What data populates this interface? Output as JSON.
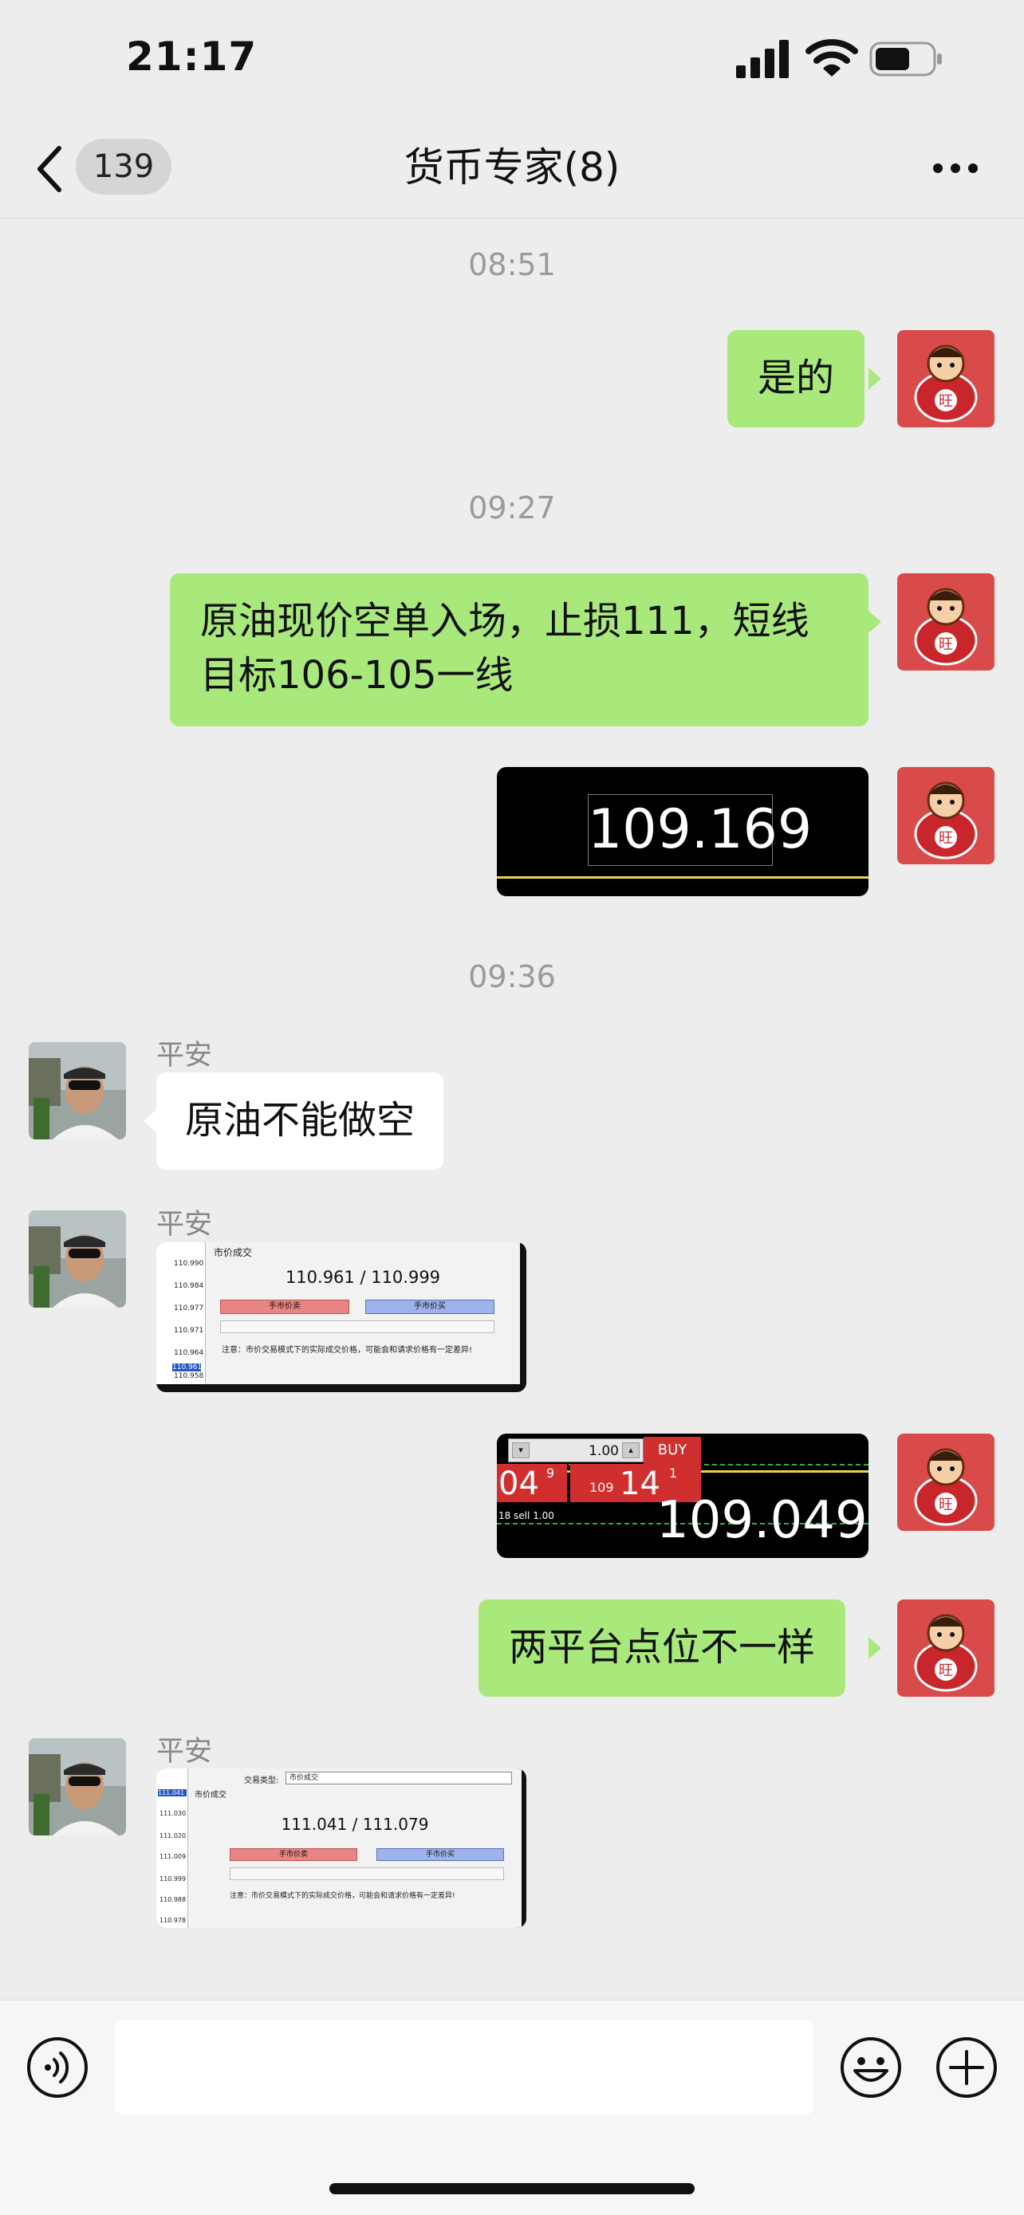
{
  "status": {
    "time": "21:17"
  },
  "nav": {
    "back_count": "139",
    "title": "货币专家(8)"
  },
  "timestamps": [
    "08:51",
    "09:27",
    "09:36"
  ],
  "messages": {
    "m1": "是的",
    "m2_line1": "原油现价空单入场，止损111，短线",
    "m2_line2": "目标106-105一线",
    "m3_price": "109.169",
    "m4_name": "平安",
    "m4_text": "原油不能做空",
    "m5_name": "平安",
    "m5_title": "市价成交",
    "m5_price": "110.961 / 110.999",
    "m5_sell": "手市价卖",
    "m5_buy": "手市价买",
    "m5_note": "注意：市价交易模式下的实际成交价格，可能会和请求价格有一定差异!",
    "m5_ticks": [
      "110.990",
      "110.984",
      "110.977",
      "110.971",
      "110.964",
      "110.961",
      "110.958"
    ],
    "m6_lot": "1.00",
    "m6_buy": "BUY",
    "m6_left": "04",
    "m6_left_sup": "9",
    "m6_mid_small": "109",
    "m6_mid": "14",
    "m6_mid_sup": "1",
    "m6_sell": "18 sell 1.00",
    "m6_price": "109.049",
    "m7": "两平台点位不一样",
    "m8_name": "平安",
    "m8_type_label": "交易类型:",
    "m8_type_value": "市价成交",
    "m8_title": "市价成交",
    "m8_price": "111.041 / 111.079",
    "m8_sell": "手市价卖",
    "m8_buy": "手市价买",
    "m8_note": "注意：市价交易模式下的实际成交价格，可能会和请求价格有一定差异!",
    "m8_ticks": [
      "111.041",
      "111.030",
      "111.020",
      "111.009",
      "110.999",
      "110.988",
      "110.978"
    ]
  },
  "colors": {
    "bubble_me": "#a9e97b",
    "bubble_other": "#ffffff",
    "background": "#ededed",
    "avatar_me_bg": "#d94b4b"
  },
  "icons": [
    "signal-icon",
    "wifi-icon",
    "battery-icon",
    "back-icon",
    "more-icon",
    "voice-icon",
    "emoji-icon",
    "plus-icon"
  ]
}
